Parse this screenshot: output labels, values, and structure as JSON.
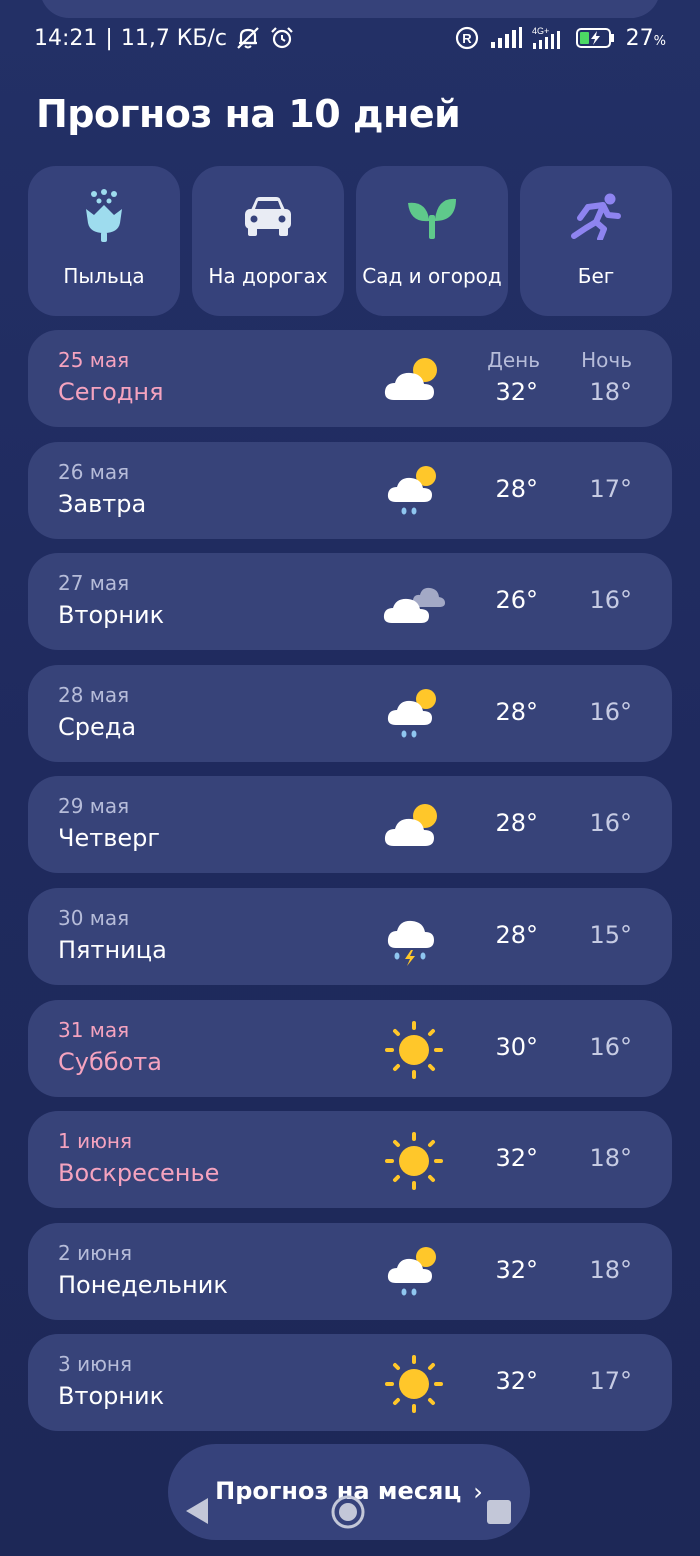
{
  "status_bar": {
    "time": "14:21",
    "speed": "11,7 КБ/с",
    "network": "4G+",
    "battery_percent": "27",
    "battery_unit": "%",
    "icons": [
      "bell-muted-icon",
      "alarm-icon",
      "registered-icon",
      "signal-icon",
      "signal-4g-icon",
      "battery-charging-icon"
    ]
  },
  "title": "Прогноз на 10 дней",
  "tiles": [
    {
      "label": "Пыльца",
      "icon": "pollen-flower-icon",
      "color": "#9edcee"
    },
    {
      "label": "На дорогах",
      "icon": "car-icon",
      "color": "#e9ecf4"
    },
    {
      "label": "Сад и огород",
      "icon": "sprout-icon",
      "color": "#5fc98b"
    },
    {
      "label": "Бег",
      "icon": "runner-icon",
      "color": "#8e84f0"
    }
  ],
  "columns": {
    "day": "День",
    "night": "Ночь"
  },
  "days": [
    {
      "date": "25 мая",
      "name": "Сегодня",
      "day_temp": "32°",
      "night_temp": "18°",
      "icon": "partly-cloudy-icon",
      "weekend": true
    },
    {
      "date": "26 мая",
      "name": "Завтра",
      "day_temp": "28°",
      "night_temp": "17°",
      "icon": "cloud-sun-rain-icon",
      "weekend": false
    },
    {
      "date": "27 мая",
      "name": "Вторник",
      "day_temp": "26°",
      "night_temp": "16°",
      "icon": "overcast-icon",
      "weekend": false
    },
    {
      "date": "28 мая",
      "name": "Среда",
      "day_temp": "28°",
      "night_temp": "16°",
      "icon": "cloud-sun-rain-icon",
      "weekend": false
    },
    {
      "date": "29 мая",
      "name": "Четверг",
      "day_temp": "28°",
      "night_temp": "16°",
      "icon": "partly-cloudy-icon",
      "weekend": false
    },
    {
      "date": "30 мая",
      "name": "Пятница",
      "day_temp": "28°",
      "night_temp": "15°",
      "icon": "thunderstorm-icon",
      "weekend": false
    },
    {
      "date": "31 мая",
      "name": "Суббота",
      "day_temp": "30°",
      "night_temp": "16°",
      "icon": "sun-icon",
      "weekend": true
    },
    {
      "date": "1 июня",
      "name": "Воскресенье",
      "day_temp": "32°",
      "night_temp": "18°",
      "icon": "sun-icon",
      "weekend": true
    },
    {
      "date": "2 июня",
      "name": "Понедельник",
      "day_temp": "32°",
      "night_temp": "18°",
      "icon": "cloud-sun-rain-icon",
      "weekend": false
    },
    {
      "date": "3 июня",
      "name": "Вторник",
      "day_temp": "32°",
      "night_temp": "17°",
      "icon": "sun-icon",
      "weekend": false
    }
  ],
  "month_button": {
    "label": "Прогноз на месяц",
    "chevron": "›"
  },
  "nav_bar": {
    "icons": [
      "back-icon",
      "home-icon",
      "recents-icon"
    ]
  },
  "colors": {
    "background": "#1f2a60",
    "card": "#374379",
    "weekend_text": "#f5a3bf",
    "secondary_text": "#b6bcd9",
    "sun": "#ffc72a"
  }
}
